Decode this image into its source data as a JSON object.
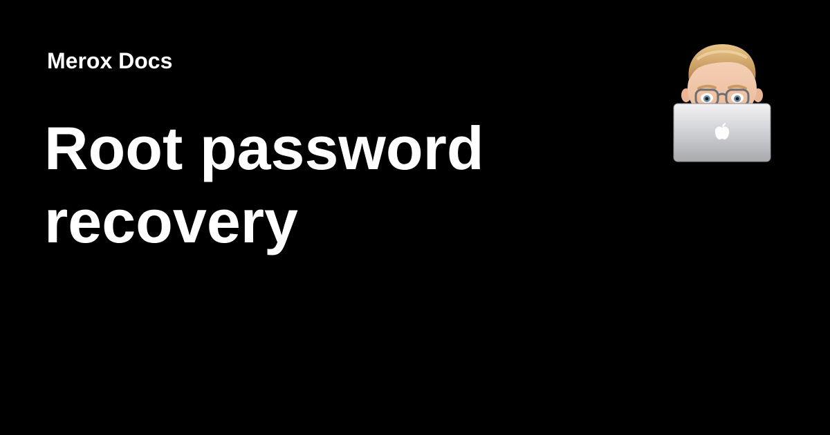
{
  "site": {
    "name": "Merox Docs"
  },
  "page": {
    "title": "Root password recovery"
  },
  "avatar": {
    "icon": "memoji-laptop-avatar",
    "laptop_logo_icon": "apple-logo-icon"
  },
  "colors": {
    "background": "#000000",
    "text": "#ffffff"
  }
}
